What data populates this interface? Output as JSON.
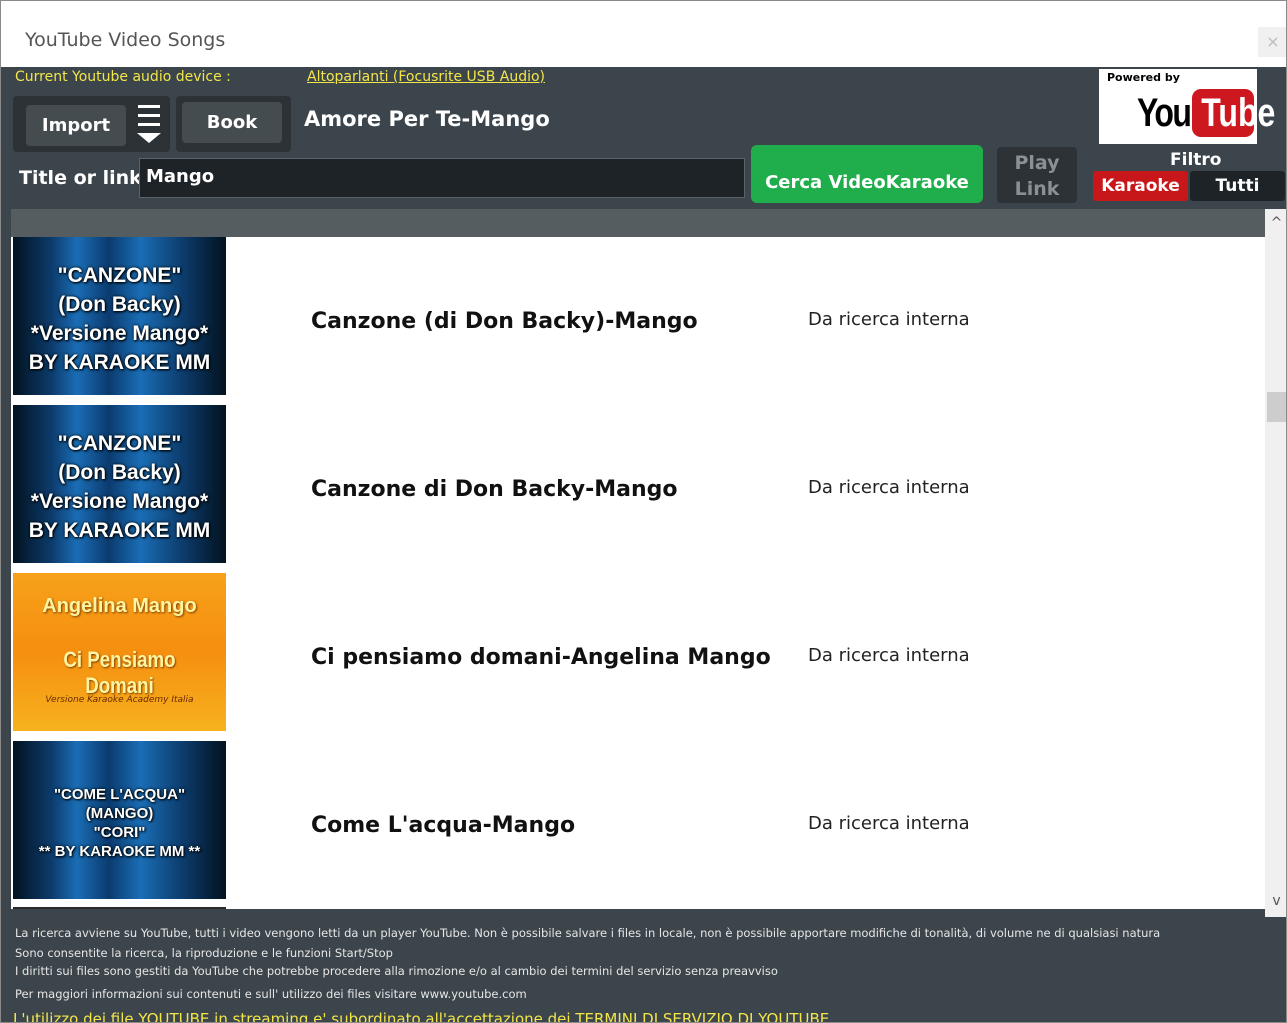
{
  "window": {
    "title": "YouTube Video Songs",
    "close": "×"
  },
  "device": {
    "label": "Current Youtube audio device :",
    "value": "Altoparlanti (Focusrite USB Audio)"
  },
  "toolbar": {
    "import_label": "Import",
    "book_label": "Book",
    "now_playing": "Amore Per Te-Mango"
  },
  "logo": {
    "powered_by": "Powered by",
    "you": "You",
    "tube": "Tube"
  },
  "search": {
    "label": "Title or link",
    "value": "Mango",
    "button_label": "Cerca VideoKaraoke",
    "play_link_line1": "Play",
    "play_link_line2": "Link"
  },
  "filter": {
    "label": "Filtro",
    "karaoke": "Karaoke",
    "tutti": "Tutti"
  },
  "results": [
    {
      "title": "Canzone (di Don Backy)-Mango",
      "source": "Da ricerca interna",
      "thumb_lines": [
        "\"CANZONE\"",
        "(Don Backy)",
        "*Versione Mango*",
        "BY KARAOKE MM"
      ]
    },
    {
      "title": "Canzone di Don Backy-Mango",
      "source": "Da ricerca interna",
      "thumb_lines": [
        "\"CANZONE\"",
        "(Don Backy)",
        "*Versione Mango*",
        "BY KARAOKE MM"
      ]
    },
    {
      "title": "Ci pensiamo domani-Angelina Mango",
      "source": "Da ricerca interna",
      "thumb_lines": [
        "Angelina Mango",
        "Ci Pensiamo Domani",
        "Versione Karaoke Academy Italia"
      ]
    },
    {
      "title": "Come L'acqua-Mango",
      "source": "Da ricerca interna",
      "thumb_lines": [
        "\"COME L'ACQUA\"",
        "(MANGO)",
        "\"CORI\"",
        "** BY KARAOKE MM **"
      ]
    }
  ],
  "scrollbar": {
    "up": "^",
    "down": "v"
  },
  "footer": {
    "line1": "La ricerca avviene su YouTube, tutti i video vengono letti da un player YouTube. Non è possibile salvare i files in locale, non è possibile apportare modifiche di tonalità, di volume ne di qualsiasi natura",
    "line2": "Sono consentite la ricerca, la riproduzione e le funzioni Start/Stop",
    "line3": "I diritti sui files sono gestiti da YouTube che potrebbe procedere alla rimozione e/o al cambio dei termini del servizio senza preavviso",
    "line4": "Per maggiori informazioni sui contenuti e sull' utilizzo dei files visitare www.youtube.com",
    "line5": "L'utilizzo dei file YOUTUBE in streaming e' subordinato all'accettazione dei TERMINI DI SERVIZIO DI YOUTUBE"
  }
}
